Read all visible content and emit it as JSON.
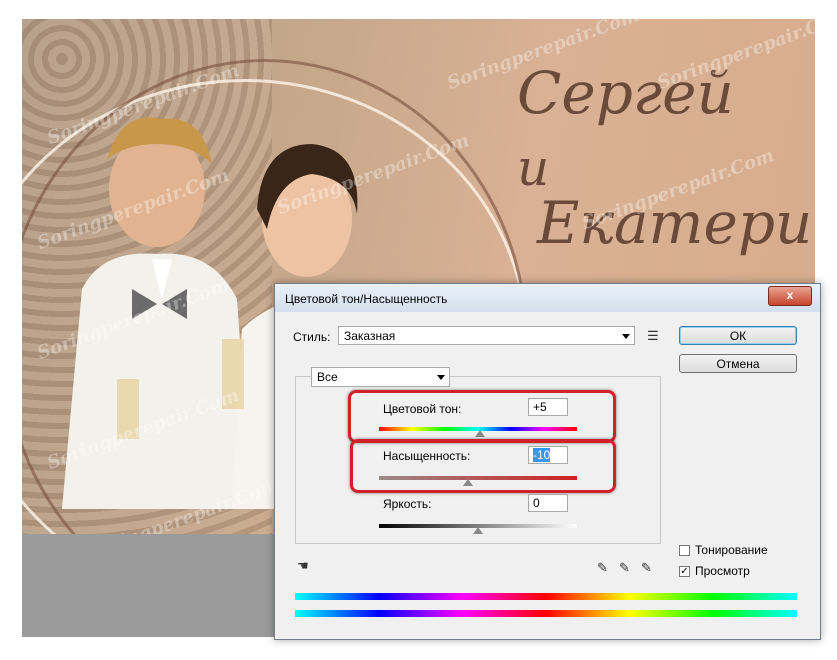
{
  "photo": {
    "script_line1": "Сергей",
    "script_line2": "и",
    "script_line3": "Екатерина",
    "watermark": "Soringperepair.Com"
  },
  "dialog": {
    "title": "Цветовой тон/Насыщенность",
    "close_label": "x",
    "style_label": "Стиль:",
    "style_value": "Заказная",
    "ok_label": "ОК",
    "cancel_label": "Отмена",
    "channel_value": "Все",
    "hue": {
      "label": "Цветовой тон:",
      "value": "+5",
      "level": 0.51
    },
    "saturation": {
      "label": "Насыщенность:",
      "value": "-10",
      "level": 0.45
    },
    "lightness": {
      "label": "Яркость:",
      "value": "0",
      "level": 0.5
    },
    "colorize_label": "Тонирование",
    "preview_label": "Просмотр",
    "preview_checked": "✓",
    "colors": {
      "highlight": "#d0202a",
      "accent": "#3399ff"
    }
  }
}
